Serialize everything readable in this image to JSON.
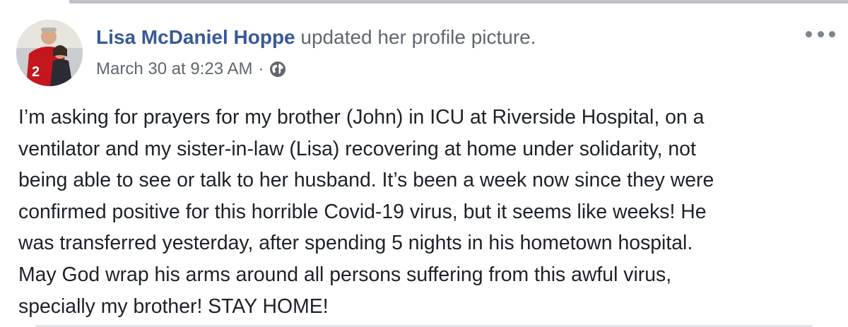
{
  "post": {
    "author": "Lisa McDaniel Hoppe",
    "action": "updated her profile picture.",
    "timestamp": "March 30 at 9:23 AM",
    "separator": "·",
    "privacy_icon": "globe-icon",
    "more_icon": "more-options-icon",
    "body_lines": [
      "I’m asking for prayers for my brother (John) in ICU at Riverside Hospital, on a",
      "ventilator and my sister-in-law (Lisa) recovering at home under solidarity, not",
      "being able to see or talk to her husband. It’s been a week now since they were",
      "confirmed positive for this horrible Covid-19 virus, but it seems like weeks! He",
      "was transferred yesterday, after spending 5 nights in his hometown hospital.",
      "May God wrap his arms around all persons suffering from this awful virus,",
      "specially my brother! STAY HOME!"
    ]
  },
  "colors": {
    "author": "#385898",
    "secondary_text": "#606770",
    "body_text": "#1d2129"
  }
}
